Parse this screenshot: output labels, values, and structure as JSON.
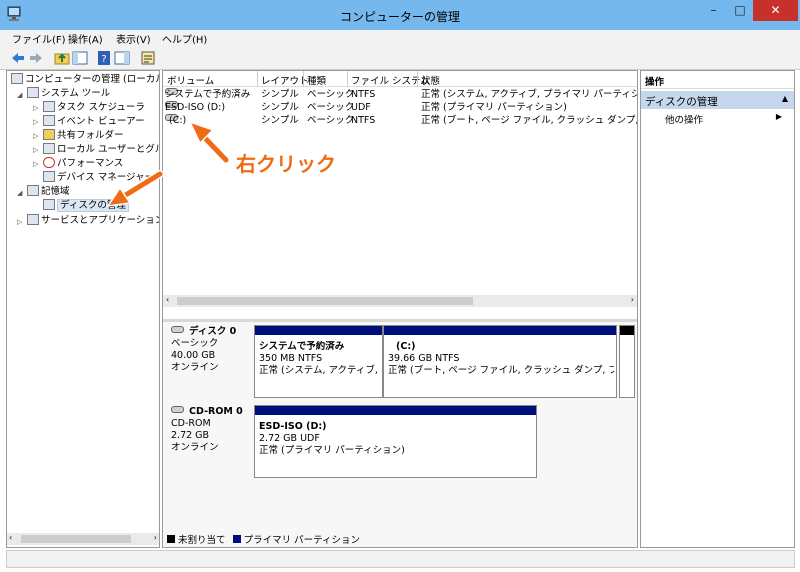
{
  "window": {
    "title": "コンピューターの管理",
    "minimize": "–",
    "maximize": "□",
    "close": "✕"
  },
  "menu": {
    "file": "ファイル(F)",
    "action": "操作(A)",
    "view": "表示(V)",
    "help": "ヘルプ(H)"
  },
  "tree": {
    "root": "コンピューターの管理 (ローカル)",
    "system_tools": "システム ツール",
    "task_scheduler": "タスク スケジューラ",
    "event_viewer": "イベント ビューアー",
    "shared_folders": "共有フォルダー",
    "local_users": "ローカル ユーザーとグループ",
    "performance": "パフォーマンス",
    "device_manager": "デバイス マネージャー",
    "storage": "記憶域",
    "disk_management": "ディスクの管理",
    "services_apps": "サービスとアプリケーション"
  },
  "volume_table": {
    "columns": [
      "ボリューム",
      "レイアウト",
      "種類",
      "ファイル システム",
      "状態"
    ],
    "rows": [
      {
        "volume": "システムで予約済み",
        "layout": "シンプル",
        "type": "ベーシック",
        "fs": "NTFS",
        "status": "正常 (システム, アクティブ, プライマリ パーティション)"
      },
      {
        "volume": "ESD-ISO (D:)",
        "layout": "シンプル",
        "type": "ベーシック",
        "fs": "UDF",
        "status": "正常 (プライマリ パーティション)"
      },
      {
        "volume": "(C:)",
        "layout": "シンプル",
        "type": "ベーシック",
        "fs": "NTFS",
        "status": "正常 (ブート, ページ ファイル, クラッシュ ダンプ, プライマリ"
      }
    ]
  },
  "disks": [
    {
      "name": "ディスク 0",
      "type": "ベーシック",
      "size": "40.00 GB",
      "state": "オンライン",
      "partitions": [
        {
          "title": "システムで予約済み",
          "size": "350 MB NTFS",
          "status": "正常 (システム, アクティブ, プラ"
        },
        {
          "title": "(C:)",
          "size": "39.66 GB NTFS",
          "status": "正常 (ブート, ページ ファイル, クラッシュ ダンプ, プライマリ パ"
        }
      ]
    },
    {
      "name": "CD-ROM 0",
      "type": "CD-ROM",
      "size": "2.72 GB",
      "state": "オンライン",
      "partitions": [
        {
          "title": "ESD-ISO  (D:)",
          "size": "2.72 GB UDF",
          "status": "正常 (プライマリ パーティション)"
        }
      ]
    }
  ],
  "legend": {
    "unallocated": "未割り当て",
    "primary": "プライマリ パーティション"
  },
  "actions": {
    "header": "操作",
    "section": "ディスクの管理",
    "other": "他の操作"
  },
  "annotation": {
    "text": "右クリック"
  },
  "colors": {
    "titlebar": "#74b8ee",
    "close": "#c7302b",
    "partition_bar": "#000e7d",
    "annotation": "#f06b15",
    "action_section": "#c4d7ec"
  }
}
